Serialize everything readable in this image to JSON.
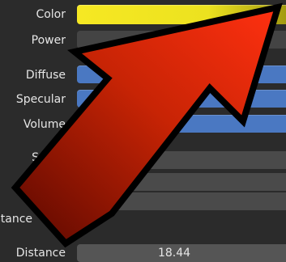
{
  "properties": {
    "color_label": "Color",
    "color_value": "#f3e622",
    "power_label": "Power",
    "diffuse_label": "Diffuse",
    "specular_label": "Specular",
    "volume_label": "Volume",
    "partial_label_s": "S",
    "partial_label_istance": "istance",
    "distance_label": "Distance",
    "distance_value": "18.44"
  },
  "overlay": {
    "icon": "red-arrow-icon",
    "fill_color": "#d62b0c",
    "outline_color": "#000000"
  }
}
